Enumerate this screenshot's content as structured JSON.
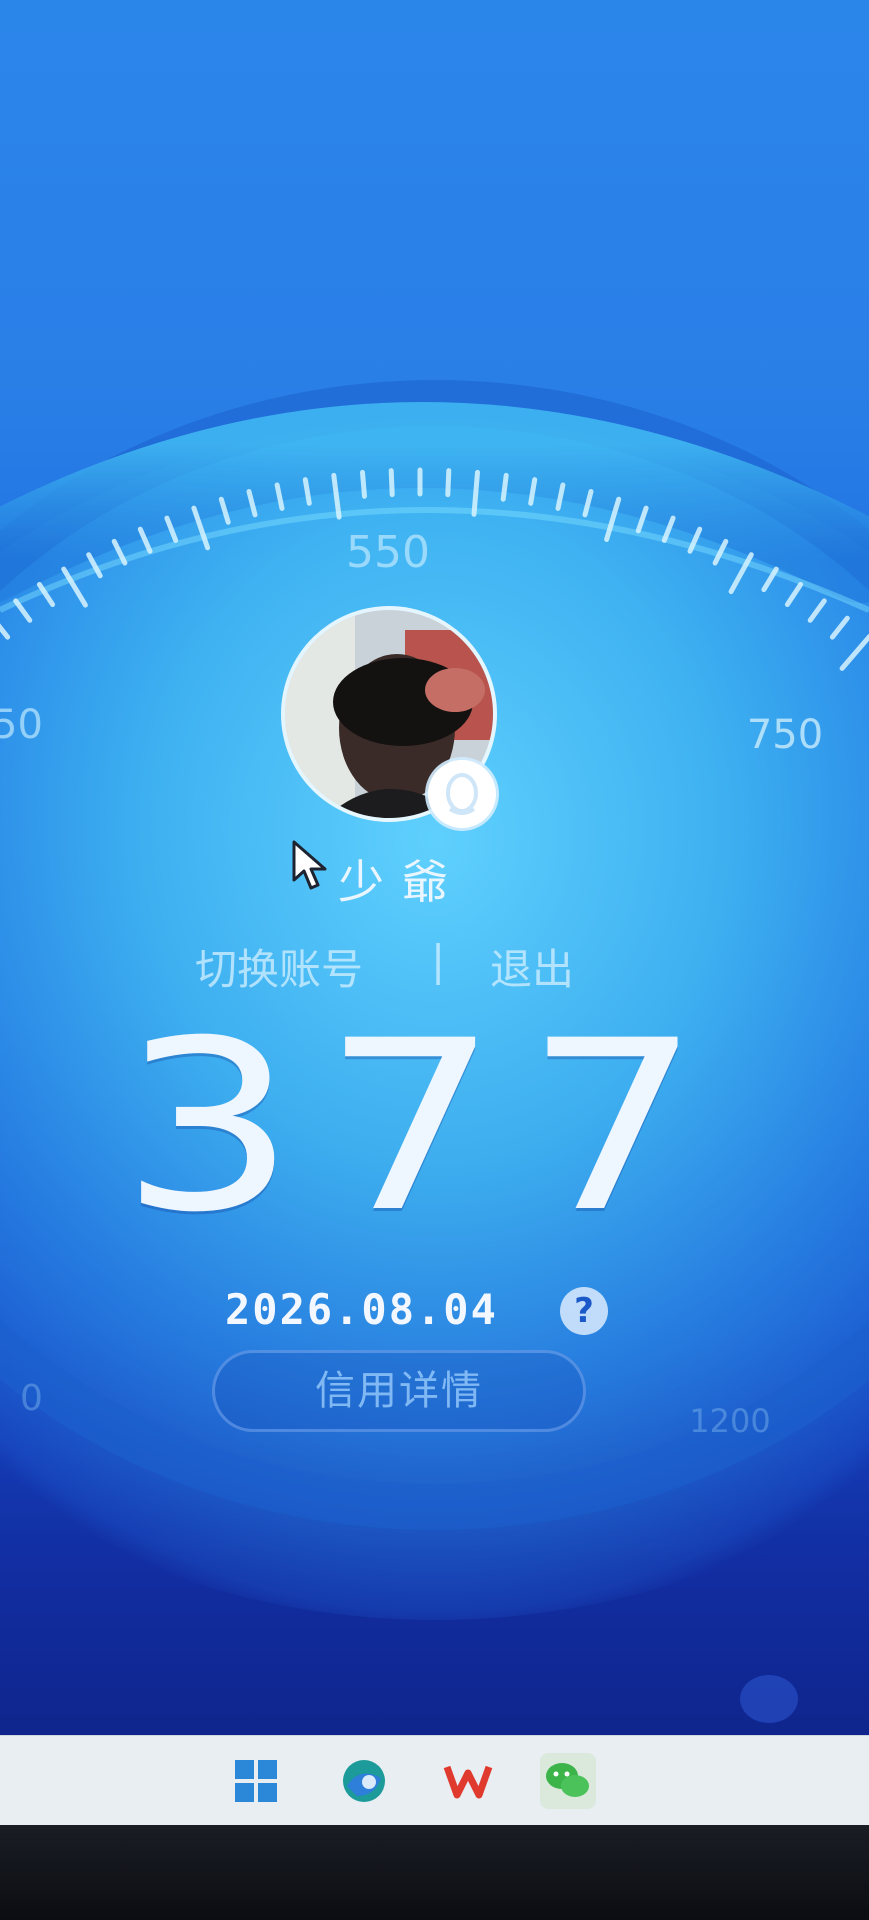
{
  "gauge": {
    "labels": {
      "left": "50",
      "top": "550",
      "right": "750",
      "bottom_left": "0",
      "bottom_right": "1200"
    }
  },
  "profile": {
    "username": "少爺",
    "avatar_icon": "user-photo",
    "badge_icon": "qq-penguin-icon"
  },
  "actions": {
    "switch_account": "切换账号",
    "divider": "|",
    "logout": "退出"
  },
  "score": {
    "value": "377",
    "date": "2026.08.04",
    "help": "?",
    "detail_button": "信用详情"
  },
  "taskbar": {
    "icons": [
      "windows-start-icon",
      "edge-browser-icon",
      "wps-office-icon",
      "wechat-icon"
    ]
  },
  "colors": {
    "background_top": "#2b86ea",
    "background_bottom": "#0f258d",
    "gauge_glow": "#63d6ff",
    "score_text": "#eef6ff"
  }
}
